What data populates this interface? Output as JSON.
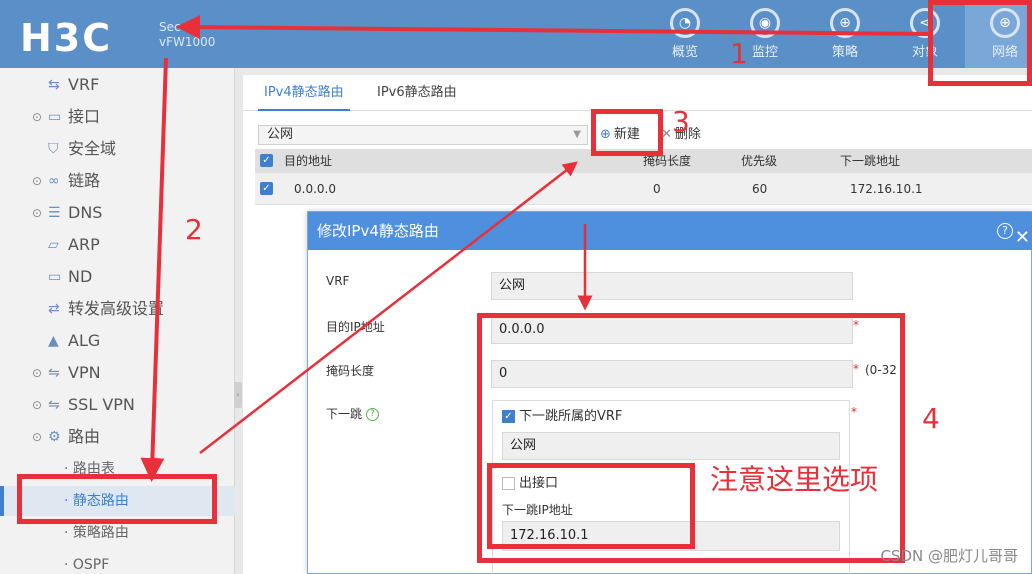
{
  "header": {
    "logo": "H3C",
    "device_line1": "Sec",
    "device_line2": "vFW1000",
    "nav": [
      {
        "label": "概览",
        "icon": "dashboard-icon",
        "glyph": "◔"
      },
      {
        "label": "监控",
        "icon": "monitor-icon",
        "glyph": "◉"
      },
      {
        "label": "策略",
        "icon": "shield-icon",
        "glyph": "⊕"
      },
      {
        "label": "对象",
        "icon": "share-icon",
        "glyph": "⋖"
      },
      {
        "label": "网络",
        "icon": "globe-icon",
        "glyph": "⊕"
      }
    ]
  },
  "sidebar": {
    "items": [
      {
        "label": "VRF",
        "icon": "vrf-icon",
        "glyph": "⇆",
        "expandable": false
      },
      {
        "label": "接口",
        "icon": "interface-icon",
        "glyph": "▭",
        "expandable": true
      },
      {
        "label": "安全域",
        "icon": "security-zone-icon",
        "glyph": "⛉",
        "expandable": false
      },
      {
        "label": "链路",
        "icon": "link-icon",
        "glyph": "∞",
        "expandable": true
      },
      {
        "label": "DNS",
        "icon": "dns-icon",
        "glyph": "☰",
        "expandable": true
      },
      {
        "label": "ARP",
        "icon": "arp-icon",
        "glyph": "▱",
        "expandable": false
      },
      {
        "label": "ND",
        "icon": "nd-icon",
        "glyph": "▭",
        "expandable": false
      },
      {
        "label": "转发高级设置",
        "icon": "forwarding-icon",
        "glyph": "⇄",
        "expandable": false
      },
      {
        "label": "ALG",
        "icon": "alg-icon",
        "glyph": "▲",
        "expandable": false
      },
      {
        "label": "VPN",
        "icon": "vpn-icon",
        "glyph": "⇋",
        "expandable": true
      },
      {
        "label": "SSL VPN",
        "icon": "ssl-vpn-icon",
        "glyph": "⇋",
        "expandable": true
      },
      {
        "label": "路由",
        "icon": "route-icon",
        "glyph": "⚙",
        "expandable": true
      }
    ],
    "sub_items": [
      {
        "label": "· 路由表"
      },
      {
        "label": "· 静态路由"
      },
      {
        "label": "· 策略路由"
      },
      {
        "label": "· OSPF"
      }
    ]
  },
  "main": {
    "tabs": [
      {
        "label": "IPv4静态路由"
      },
      {
        "label": "IPv6静态路由"
      }
    ],
    "vrf_select": "公网",
    "toolbar": {
      "new_label": "新建",
      "delete_label": "删除"
    },
    "table": {
      "headers": [
        "目的地址",
        "掩码长度",
        "优先级",
        "下一跳地址"
      ],
      "rows": [
        {
          "dest": "0.0.0.0",
          "mask": "0",
          "priority": "60",
          "next_hop": "172.16.10.1"
        }
      ]
    }
  },
  "dialog": {
    "title": "修改IPv4静态路由",
    "help": "?",
    "close": "✕",
    "vrf_label": "VRF",
    "vrf_value": "公网",
    "dest_label": "目的IP地址",
    "dest_value": "0.0.0.0",
    "mask_label": "掩码长度",
    "mask_value": "0",
    "mask_hint": "(0-32",
    "nexthop_label": "下一跳",
    "nexthop_vrf_checkbox": "下一跳所属的VRF",
    "nexthop_vrf_value": "公网",
    "out_interface_checkbox": "出接口",
    "nexthop_ip_label": "下一跳IP地址",
    "nexthop_ip_value": "172.16.10.1",
    "required_mark": "*"
  },
  "annotations": {
    "n1": "1",
    "n2": "2",
    "n3": "3",
    "n4": "4",
    "note": "注意这里选项",
    "color": "#e8303a"
  },
  "watermark": "CSDN @肥灯儿哥哥"
}
